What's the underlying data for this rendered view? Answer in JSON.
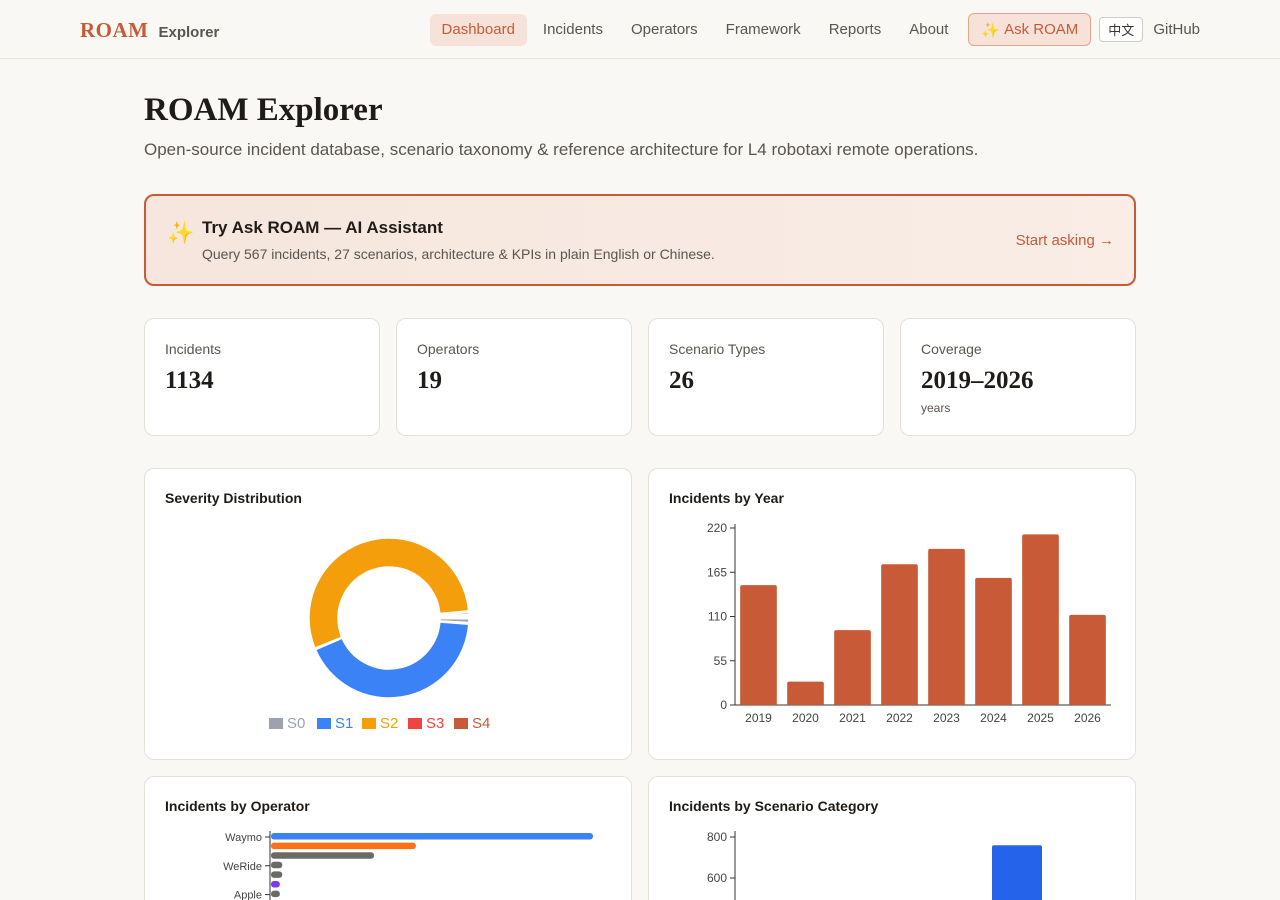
{
  "nav": {
    "brand": "ROAM",
    "brand_sub": "Explorer",
    "items": [
      "Dashboard",
      "Incidents",
      "Operators",
      "Framework",
      "Reports",
      "About"
    ],
    "ask": "Ask ROAM",
    "ask_icon": "✨",
    "lang": "中文",
    "github": "GitHub"
  },
  "page": {
    "title": "ROAM Explorer",
    "subtitle": "Open-source incident database, scenario taxonomy & reference architecture for L4 robotaxi remote operations."
  },
  "banner": {
    "icon": "✨",
    "title": "Try Ask ROAM — AI Assistant",
    "desc": "Query 567 incidents, 27 scenarios, architecture & KPIs in plain English or Chinese.",
    "cta": "Start asking →"
  },
  "stats": [
    {
      "label": "Incidents",
      "value": "1134",
      "note": ""
    },
    {
      "label": "Operators",
      "value": "19",
      "note": ""
    },
    {
      "label": "Scenario Types",
      "value": "26",
      "note": ""
    },
    {
      "label": "Coverage",
      "value": "2019–2026",
      "note": "years"
    }
  ],
  "colors": {
    "accent": "#c95a38",
    "s0": "#9ca3af",
    "s1": "#3b82f6",
    "s2": "#f59e0b",
    "s3": "#ef4444",
    "s4": "#c95a38"
  },
  "chart_data": [
    {
      "type": "pie",
      "title": "Severity Distribution",
      "categories": [
        "S0",
        "S1",
        "S2",
        "S3",
        "S4"
      ],
      "values": [
        12,
        480,
        620,
        8,
        6
      ],
      "colors": [
        "#9ca3af",
        "#3b82f6",
        "#f59e0b",
        "#ef4444",
        "#c95a38"
      ],
      "legend": "bottom"
    },
    {
      "type": "bar",
      "title": "Incidents by Year",
      "categories": [
        "2019",
        "2020",
        "2021",
        "2022",
        "2023",
        "2024",
        "2025",
        "2026"
      ],
      "values": [
        149,
        29,
        93,
        175,
        194,
        158,
        212,
        112
      ],
      "ylim": [
        0,
        220
      ],
      "yticks": [
        0,
        55,
        110,
        165,
        220
      ],
      "color": "#c95a38"
    },
    {
      "type": "bar",
      "orientation": "horizontal",
      "title": "Incidents by Operator",
      "tick_labels": [
        "Waymo",
        "WeRide",
        "Apple"
      ],
      "values": [
        400,
        180,
        128,
        14,
        14,
        11,
        11
      ],
      "colors": [
        "#3b82f6",
        "#f97316",
        "#6b6b66",
        "#6b6b66",
        "#6b6b66",
        "#7c3aed",
        "#6b6b66"
      ]
    },
    {
      "type": "bar",
      "title": "Incidents by Scenario Category",
      "yticks": [
        600,
        800
      ],
      "values": [
        760
      ],
      "color": "#2563eb"
    }
  ]
}
